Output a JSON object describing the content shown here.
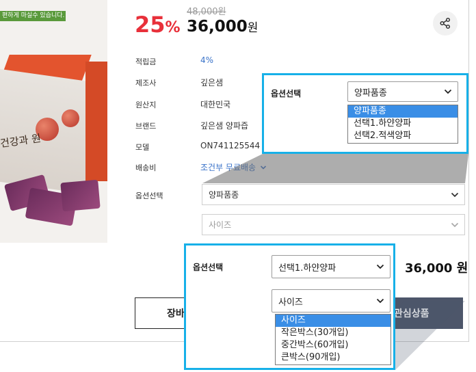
{
  "image_banner": "편하게 마실수 있습니다.",
  "image_label": "건강과 원",
  "price": {
    "discount_number": "25",
    "discount_unit": "%",
    "original": "48,000원",
    "sale_number": "36,000",
    "sale_unit": "원"
  },
  "info": {
    "rows": [
      {
        "label": "적립금",
        "value": "4%"
      },
      {
        "label": "제조사",
        "value": "깊은샘"
      },
      {
        "label": "원산지",
        "value": "대한민국"
      },
      {
        "label": "브랜드",
        "value": "깊은샘 양파즙"
      },
      {
        "label": "모델",
        "value": "ON741125544"
      },
      {
        "label": "배송비",
        "value": "조건부 무료배송"
      }
    ]
  },
  "options": {
    "label": "옵션선택",
    "select1_value": "양파품종",
    "select2_value": "사이즈"
  },
  "buttons": {
    "cart": "장바",
    "wish": "관심상품"
  },
  "callout1": {
    "label": "옵션선택",
    "select_value": "양파품종",
    "items": [
      "양파품종",
      "선택1.하얀양파",
      "선택2.적색양파"
    ]
  },
  "callout2": {
    "label": "옵션선택",
    "select1_value": "선택1.하얀양파",
    "select2_value": "사이즈",
    "items": [
      "사이즈",
      "작은박스(30개입)",
      "중간박스(60개입)",
      "큰박스(90개입)"
    ],
    "total": "36,000 원"
  },
  "colors": {
    "discount": "#e8303a",
    "link": "#3a73c9",
    "callout_border": "#16b0e8",
    "dropdown_highlight": "#3a8ee6",
    "wish_button": "#4d566a"
  },
  "icons": [
    "share-icon",
    "chevron-down-icon"
  ]
}
